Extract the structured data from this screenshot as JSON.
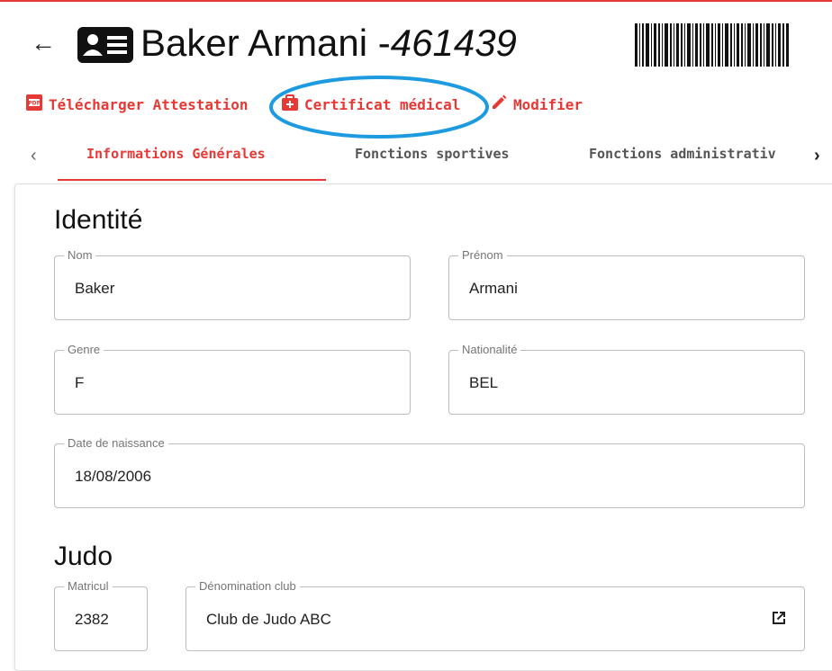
{
  "header": {
    "name": "Baker Armani",
    "separator": " -",
    "member_number": "461439"
  },
  "actions": {
    "download_label": "Télécharger Attestation",
    "certificate_label": "Certificat médical",
    "edit_label": "Modifier"
  },
  "tabs": [
    {
      "label": "Informations Générales"
    },
    {
      "label": "Fonctions sportives"
    },
    {
      "label": "Fonctions administrativ"
    }
  ],
  "identity": {
    "title": "Identité",
    "fields": {
      "nom": {
        "label": "Nom",
        "value": "Baker"
      },
      "prenom": {
        "label": "Prénom",
        "value": "Armani"
      },
      "genre": {
        "label": "Genre",
        "value": "F"
      },
      "nationalite": {
        "label": "Nationalité",
        "value": "BEL"
      },
      "naissance": {
        "label": "Date de naissance",
        "value": "18/08/2006"
      }
    }
  },
  "judo": {
    "title": "Judo",
    "fields": {
      "matricule": {
        "label": "Matricul",
        "value": "2382"
      },
      "club": {
        "label": "Dénomination club",
        "value": "Club de Judo ABC"
      }
    }
  },
  "colors": {
    "accent": "#e53935",
    "annotation": "#1e9be0"
  }
}
